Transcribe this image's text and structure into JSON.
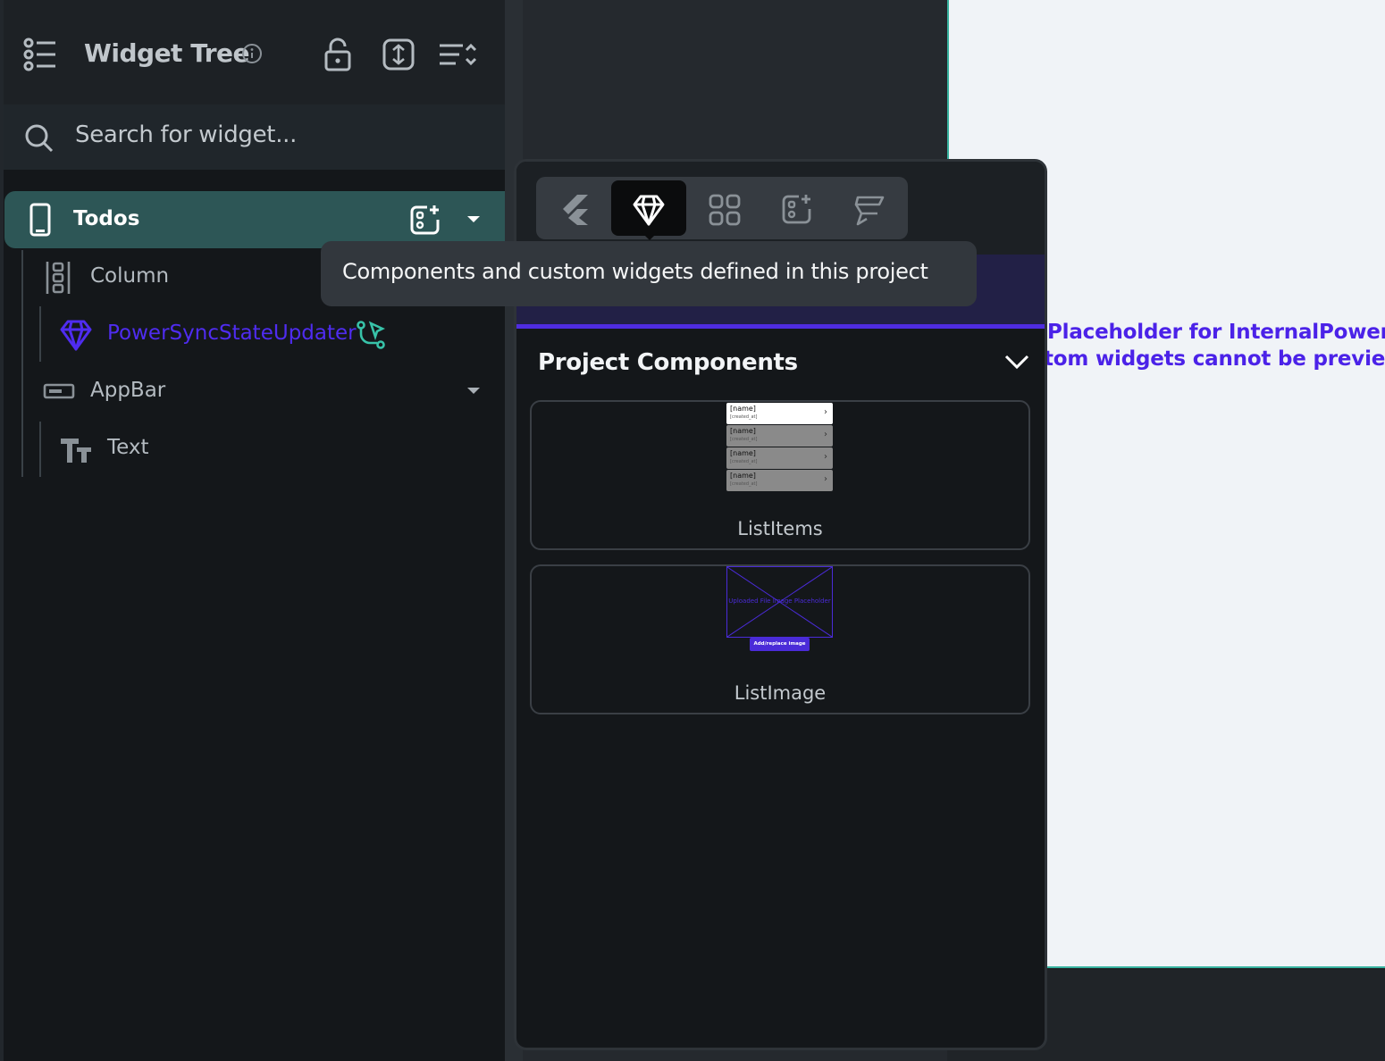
{
  "panel": {
    "title": "Widget Tree",
    "search_placeholder": "Search for widget..."
  },
  "tree": {
    "root": "Todos",
    "items": [
      {
        "label": "Column"
      },
      {
        "label": "PowerSyncStateUpdater"
      },
      {
        "label": "AppBar"
      },
      {
        "label": "Text"
      }
    ]
  },
  "tooltip": {
    "text": "Components and custom widgets defined in this project"
  },
  "popover": {
    "section_title": "Project Components",
    "components": [
      {
        "label": "ListItems"
      },
      {
        "label": "ListImage"
      }
    ],
    "thumb_list": {
      "name": "[name]",
      "created": "[created_at]"
    },
    "thumb_image": {
      "placeholder": "Uploaded File Image Placeholder",
      "button": "Add/replace image"
    }
  },
  "canvas": {
    "line1": "Placeholder for InternalPowerSyn",
    "line2": "tom widgets cannot be previewed"
  },
  "colors": {
    "accent_purple": "#4f2ce0",
    "selected_row": "#2d5656",
    "teal": "#38b3a0"
  }
}
